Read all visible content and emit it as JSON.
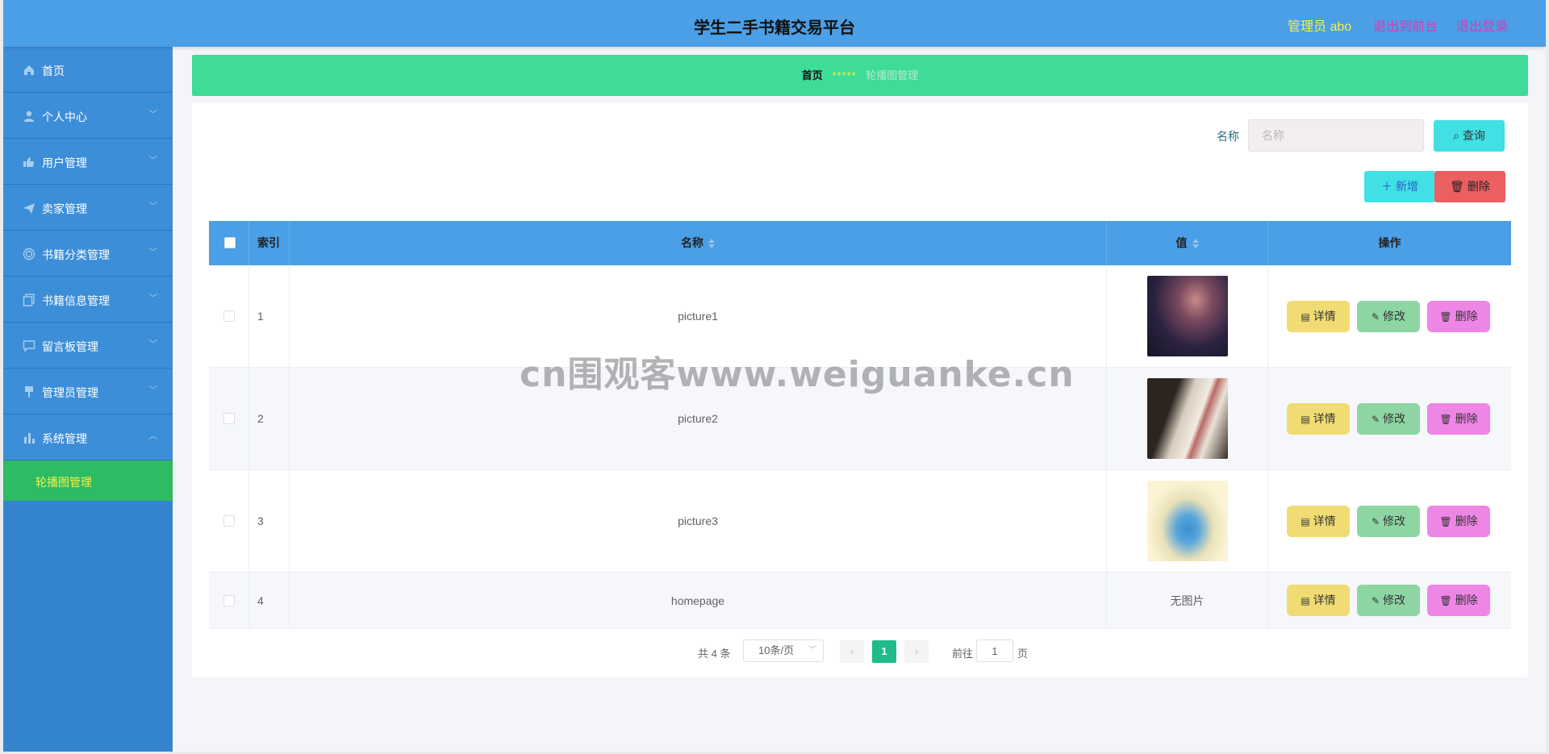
{
  "header": {
    "title": "学生二手书籍交易平台",
    "admin_label": "管理员 abo",
    "front_link": "退出到前台",
    "logout_link": "退出登录"
  },
  "sidebar": {
    "items": [
      {
        "label": "首页",
        "icon": "home-icon"
      },
      {
        "label": "个人中心",
        "icon": "user-icon"
      },
      {
        "label": "用户管理",
        "icon": "thumb-icon"
      },
      {
        "label": "卖家管理",
        "icon": "send-icon"
      },
      {
        "label": "书籍分类管理",
        "icon": "target-icon"
      },
      {
        "label": "书籍信息管理",
        "icon": "copy-icon"
      },
      {
        "label": "留言板管理",
        "icon": "chat-icon"
      },
      {
        "label": "管理员管理",
        "icon": "pin-icon"
      },
      {
        "label": "系统管理",
        "icon": "chart-icon"
      }
    ],
    "submenu": {
      "label": "轮播图管理"
    }
  },
  "breadcrumb": {
    "home": "首页",
    "separator": "*****",
    "current": "轮播图管理"
  },
  "search": {
    "label": "名称",
    "placeholder": "名称",
    "query_button": "查询"
  },
  "toolbar": {
    "add_button": "新增",
    "delete_button": "删除"
  },
  "table": {
    "columns": {
      "index": "索引",
      "name": "名称",
      "value": "值",
      "actions": "操作"
    },
    "rows": [
      {
        "index": "1",
        "name": "picture1",
        "image": "picture1",
        "value_text": ""
      },
      {
        "index": "2",
        "name": "picture2",
        "image": "picture2",
        "value_text": ""
      },
      {
        "index": "3",
        "name": "picture3",
        "image": "picture3",
        "value_text": ""
      },
      {
        "index": "4",
        "name": "homepage",
        "image": "",
        "value_text": "无图片"
      }
    ],
    "actions": {
      "detail": "详情",
      "edit": "修改",
      "delete": "删除"
    }
  },
  "pagination": {
    "total": "共 4 条",
    "page_size": "10条/页",
    "current_page": "1",
    "goto_label": "前往",
    "goto_value": "1",
    "page_unit": "页"
  },
  "watermark": "cn围观客www.weiguanke.cn",
  "colors": {
    "header": "#4a9fe6",
    "sidebar": "#3585ce",
    "breadcrumb": "#3fdc97",
    "active_submenu": "#2dbb64"
  }
}
